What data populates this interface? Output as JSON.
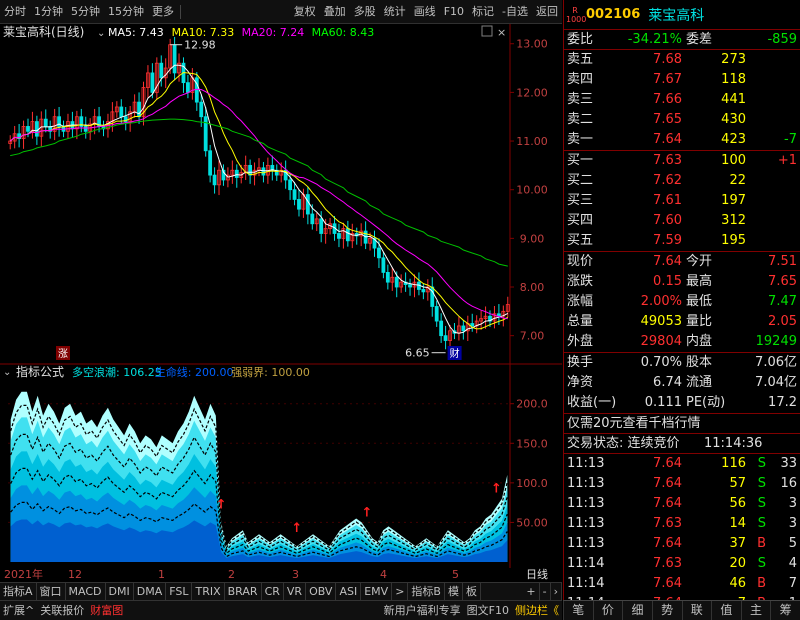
{
  "toolbar": {
    "periods": [
      "分时",
      "1分钟",
      "5分钟",
      "15分钟",
      "更多"
    ],
    "actions": [
      "复权",
      "叠加",
      "多股",
      "统计",
      "画线",
      "F10",
      "标记",
      "-自选",
      "返回"
    ]
  },
  "chart_data": [
    {
      "type": "candlestick",
      "title": "莱宝高科(日线)",
      "ma_labels": [
        {
          "text": "MA5: 7.43",
          "color": "#ffffff"
        },
        {
          "text": "MA10: 7.33",
          "color": "#ffff00"
        },
        {
          "text": "MA20: 7.24",
          "color": "#ff00ff"
        },
        {
          "text": "MA60: 8.43",
          "color": "#00ff00"
        }
      ],
      "ylim": [
        6.5,
        13.2
      ],
      "yticks": [
        "13.00",
        "12.00",
        "11.00",
        "10.00",
        "9.00",
        "8.00",
        "7.00"
      ],
      "ytick_values": [
        13,
        12,
        11,
        10,
        9,
        8,
        7
      ],
      "annotations": {
        "high": "12.98",
        "low": "6.65",
        "rise_mark": "涨",
        "fin_mark": "财"
      },
      "closes": [
        11.0,
        11.15,
        11.05,
        11.3,
        11.2,
        11.4,
        11.1,
        11.45,
        11.3,
        11.2,
        11.5,
        11.3,
        11.2,
        11.4,
        11.25,
        11.5,
        11.3,
        11.2,
        11.35,
        11.5,
        11.3,
        11.25,
        11.4,
        11.6,
        11.7,
        11.5,
        11.4,
        11.6,
        11.8,
        11.5,
        12.1,
        12.4,
        12.0,
        12.6,
        12.3,
        12.5,
        12.98,
        12.4,
        12.6,
        12.2,
        12.0,
        12.3,
        11.8,
        11.5,
        10.8,
        10.3,
        10.1,
        10.4,
        10.2,
        10.3,
        10.4,
        10.25,
        10.35,
        10.5,
        10.3,
        10.4,
        10.45,
        10.3,
        10.5,
        10.4,
        10.3,
        10.4,
        10.2,
        10.0,
        9.8,
        9.6,
        9.9,
        9.5,
        9.3,
        9.4,
        9.1,
        9.2,
        9.3,
        9.1,
        9.0,
        9.2,
        8.95,
        9.1,
        9.05,
        9.15,
        8.9,
        9.0,
        8.8,
        8.6,
        8.3,
        8.1,
        8.2,
        8.0,
        8.1,
        8.05,
        8.0,
        8.1,
        7.95,
        7.9,
        8.0,
        7.6,
        7.3,
        7.0,
        6.9,
        7.1,
        7.05,
        7.2,
        7.1,
        7.25,
        7.2,
        7.3,
        7.35,
        7.4,
        7.3,
        7.45,
        7.4,
        7.5,
        7.64
      ],
      "ma60": [
        10.7,
        10.74,
        10.78,
        10.82,
        10.86,
        10.9,
        10.95,
        11.0,
        11.05,
        11.1,
        11.14,
        11.18,
        11.22,
        11.26,
        11.3,
        11.33,
        11.36,
        11.38,
        11.4,
        11.42,
        11.43,
        11.44,
        11.45,
        11.45,
        11.44,
        11.42,
        11.4,
        11.38,
        11.35,
        11.3,
        11.25,
        11.2,
        11.14,
        11.08,
        11.02,
        10.95,
        10.88,
        10.8,
        10.73,
        10.65,
        10.57,
        10.49,
        10.4,
        10.31,
        10.22,
        10.13,
        10.04,
        9.95,
        9.86,
        9.77,
        9.68,
        9.59,
        9.5,
        9.42,
        9.34,
        9.27,
        9.2,
        9.13,
        9.06,
        9.0,
        8.94,
        8.88,
        8.82,
        8.76,
        8.7,
        8.64,
        8.58,
        8.52,
        8.47,
        8.43
      ]
    },
    {
      "type": "area",
      "title": "指标公式",
      "indicator_name": "多空浪潮",
      "labels": [
        {
          "text": "多空浪潮: 106.25",
          "color": "#00e0e0"
        },
        {
          "text": "生命线: 200.00",
          "color": "#0060ff"
        },
        {
          "text": "强弱界: 100.00",
          "color": "#c0a040"
        }
      ],
      "ylim": [
        0,
        235
      ],
      "yticks": [
        "200.0",
        "150.0",
        "100.0",
        "50.00"
      ],
      "ytick_values": [
        200,
        150,
        100,
        50
      ],
      "values": [
        180,
        205,
        215,
        215,
        190,
        210,
        185,
        200,
        190,
        175,
        195,
        200,
        185,
        190,
        175,
        180,
        170,
        185,
        195,
        180,
        170,
        160,
        175,
        165,
        150,
        160,
        155,
        145,
        160,
        155,
        150,
        165,
        175,
        190,
        210,
        195,
        180,
        200,
        185,
        50,
        20,
        30,
        35,
        40,
        25,
        30,
        35,
        30,
        25,
        30,
        35,
        30,
        25,
        20,
        25,
        30,
        35,
        30,
        25,
        20,
        30,
        40,
        45,
        50,
        55,
        50,
        40,
        30,
        25,
        40,
        45,
        40,
        35,
        30,
        25,
        20,
        25,
        30,
        25,
        20,
        30,
        40,
        35,
        30,
        25,
        30,
        40,
        45,
        55,
        60,
        70,
        80,
        110
      ],
      "arrow_positions": [
        39,
        53,
        66,
        90
      ]
    }
  ],
  "x_axis": {
    "labels": [
      "2021年",
      "12",
      "1",
      "2",
      "3",
      "4",
      "5",
      "日线"
    ]
  },
  "indicator_tabs": [
    "指标A",
    "窗口",
    "MACD",
    "DMI",
    "DMA",
    "FSL",
    "TRIX",
    "BRAR",
    "CR",
    "VR",
    "OBV",
    "ASI",
    "EMV",
    ">",
    "指标B",
    "模",
    "板"
  ],
  "status_bar": {
    "left": [
      "扩展^",
      "关联报价",
      "财富图"
    ],
    "right": [
      "新用户福利专享",
      "图文F10",
      "侧边栏《"
    ]
  },
  "quote": {
    "badge": "R 1000",
    "code": "002106",
    "name": "莱宝高科",
    "weibi_label": "委比",
    "weibi": "-34.21%",
    "weicha_label": "委差",
    "weicha": "-859",
    "asks": [
      {
        "label": "卖五",
        "price": "7.68",
        "vol": "273",
        "chg": ""
      },
      {
        "label": "卖四",
        "price": "7.67",
        "vol": "118",
        "chg": ""
      },
      {
        "label": "卖三",
        "price": "7.66",
        "vol": "441",
        "chg": ""
      },
      {
        "label": "卖二",
        "price": "7.65",
        "vol": "430",
        "chg": ""
      },
      {
        "label": "卖一",
        "price": "7.64",
        "vol": "423",
        "chg": "-7"
      }
    ],
    "bids": [
      {
        "label": "买一",
        "price": "7.63",
        "vol": "100",
        "chg": "+1"
      },
      {
        "label": "买二",
        "price": "7.62",
        "vol": "22",
        "chg": ""
      },
      {
        "label": "买三",
        "price": "7.61",
        "vol": "197",
        "chg": ""
      },
      {
        "label": "买四",
        "price": "7.60",
        "vol": "312",
        "chg": ""
      },
      {
        "label": "买五",
        "price": "7.59",
        "vol": "195",
        "chg": ""
      }
    ],
    "stats": [
      {
        "l1": "现价",
        "v1": "7.64",
        "c1": "red",
        "l2": "今开",
        "v2": "7.51",
        "c2": "red"
      },
      {
        "l1": "涨跌",
        "v1": "0.15",
        "c1": "red",
        "l2": "最高",
        "v2": "7.65",
        "c2": "red"
      },
      {
        "l1": "涨幅",
        "v1": "2.00%",
        "c1": "red",
        "l2": "最低",
        "v2": "7.47",
        "c2": "green"
      },
      {
        "l1": "总量",
        "v1": "49053",
        "c1": "yel",
        "l2": "量比",
        "v2": "2.05",
        "c2": "red"
      },
      {
        "l1": "外盘",
        "v1": "29804",
        "c1": "red",
        "l2": "内盘",
        "v2": "19249",
        "c2": "green"
      }
    ],
    "extra": [
      {
        "l1": "换手",
        "v1": "0.70%",
        "l2": "股本",
        "v2": "7.06亿"
      },
      {
        "l1": "净资",
        "v1": "6.74",
        "l2": "流通",
        "v2": "7.04亿"
      },
      {
        "l1": "收益(一)",
        "v1": "0.111",
        "l2": "PE(动)",
        "v2": "17.2"
      }
    ],
    "promo": "仅需20元查看千档行情",
    "trade_state_label": "交易状态: 连续竞价",
    "trade_state_time": "11:14:36",
    "ticks": [
      {
        "t": "11:13",
        "p": "7.64",
        "v": "116",
        "s": "S",
        "n": "33"
      },
      {
        "t": "11:13",
        "p": "7.64",
        "v": "57",
        "s": "S",
        "n": "16"
      },
      {
        "t": "11:13",
        "p": "7.64",
        "v": "56",
        "s": "S",
        "n": "3"
      },
      {
        "t": "11:13",
        "p": "7.63",
        "v": "14",
        "s": "S",
        "n": "3"
      },
      {
        "t": "11:13",
        "p": "7.64",
        "v": "37",
        "s": "B",
        "n": "5"
      },
      {
        "t": "11:14",
        "p": "7.63",
        "v": "20",
        "s": "S",
        "n": "4"
      },
      {
        "t": "11:14",
        "p": "7.64",
        "v": "46",
        "s": "B",
        "n": "7"
      },
      {
        "t": "11:14",
        "p": "7.64",
        "v": "7",
        "s": "B",
        "n": "1"
      }
    ]
  },
  "right_tabs": [
    "笔",
    "价",
    "细",
    "势",
    "联",
    "值",
    "主",
    "筹"
  ],
  "colors": {
    "up": "#ff3030",
    "down": "#00e000",
    "axis": "#800000",
    "ma60": "#00c000",
    "ma20": "#ff00ff",
    "ma10": "#ffff00",
    "ma5": "#ffffff"
  }
}
